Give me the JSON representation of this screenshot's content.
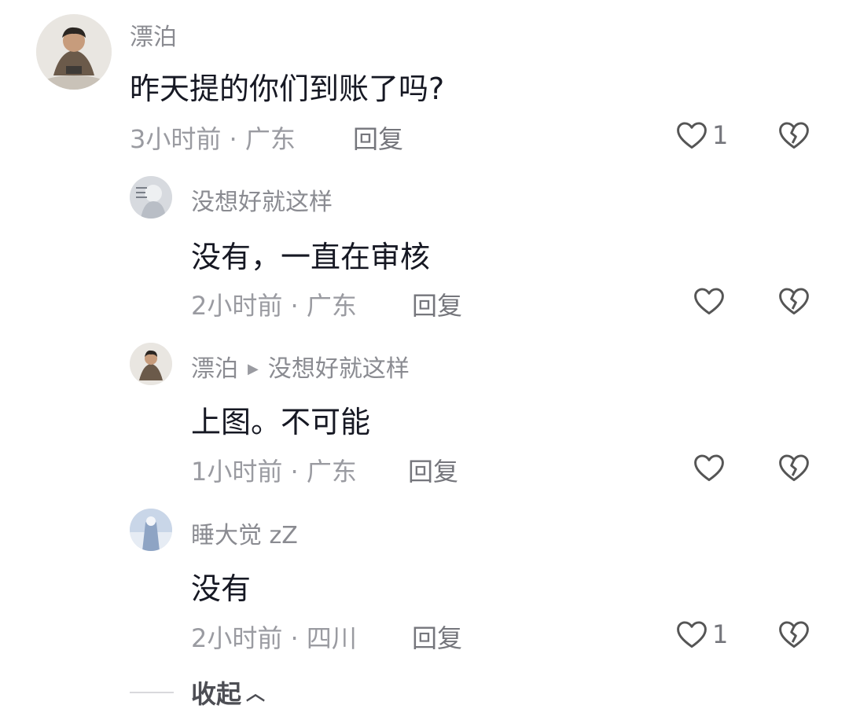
{
  "comments": [
    {
      "author": "漂泊",
      "text": "昨天提的你们到账了吗?",
      "time_location": "3小时前 · 广东",
      "reply_label": "回复",
      "likes": "1"
    },
    {
      "author": "没想好就这样",
      "text": "没有，一直在审核",
      "time_location": "2小时前 · 广东",
      "reply_label": "回复",
      "likes": ""
    },
    {
      "author": "漂泊",
      "reply_to": "没想好就这样",
      "text": "上图。不可能",
      "time_location": "1小时前 · 广东",
      "reply_label": "回复",
      "likes": ""
    },
    {
      "author": "睡大觉 zZ",
      "text": "没有",
      "time_location": "2小时前 · 四川",
      "reply_label": "回复",
      "likes": "1"
    }
  ],
  "collapse_label": "收起",
  "colors": {
    "text": "#161823",
    "meta": "#9a9ba1",
    "name": "#8a8b91"
  },
  "icons": [
    "heart-icon",
    "broken-heart-icon",
    "chevron-up-icon"
  ]
}
